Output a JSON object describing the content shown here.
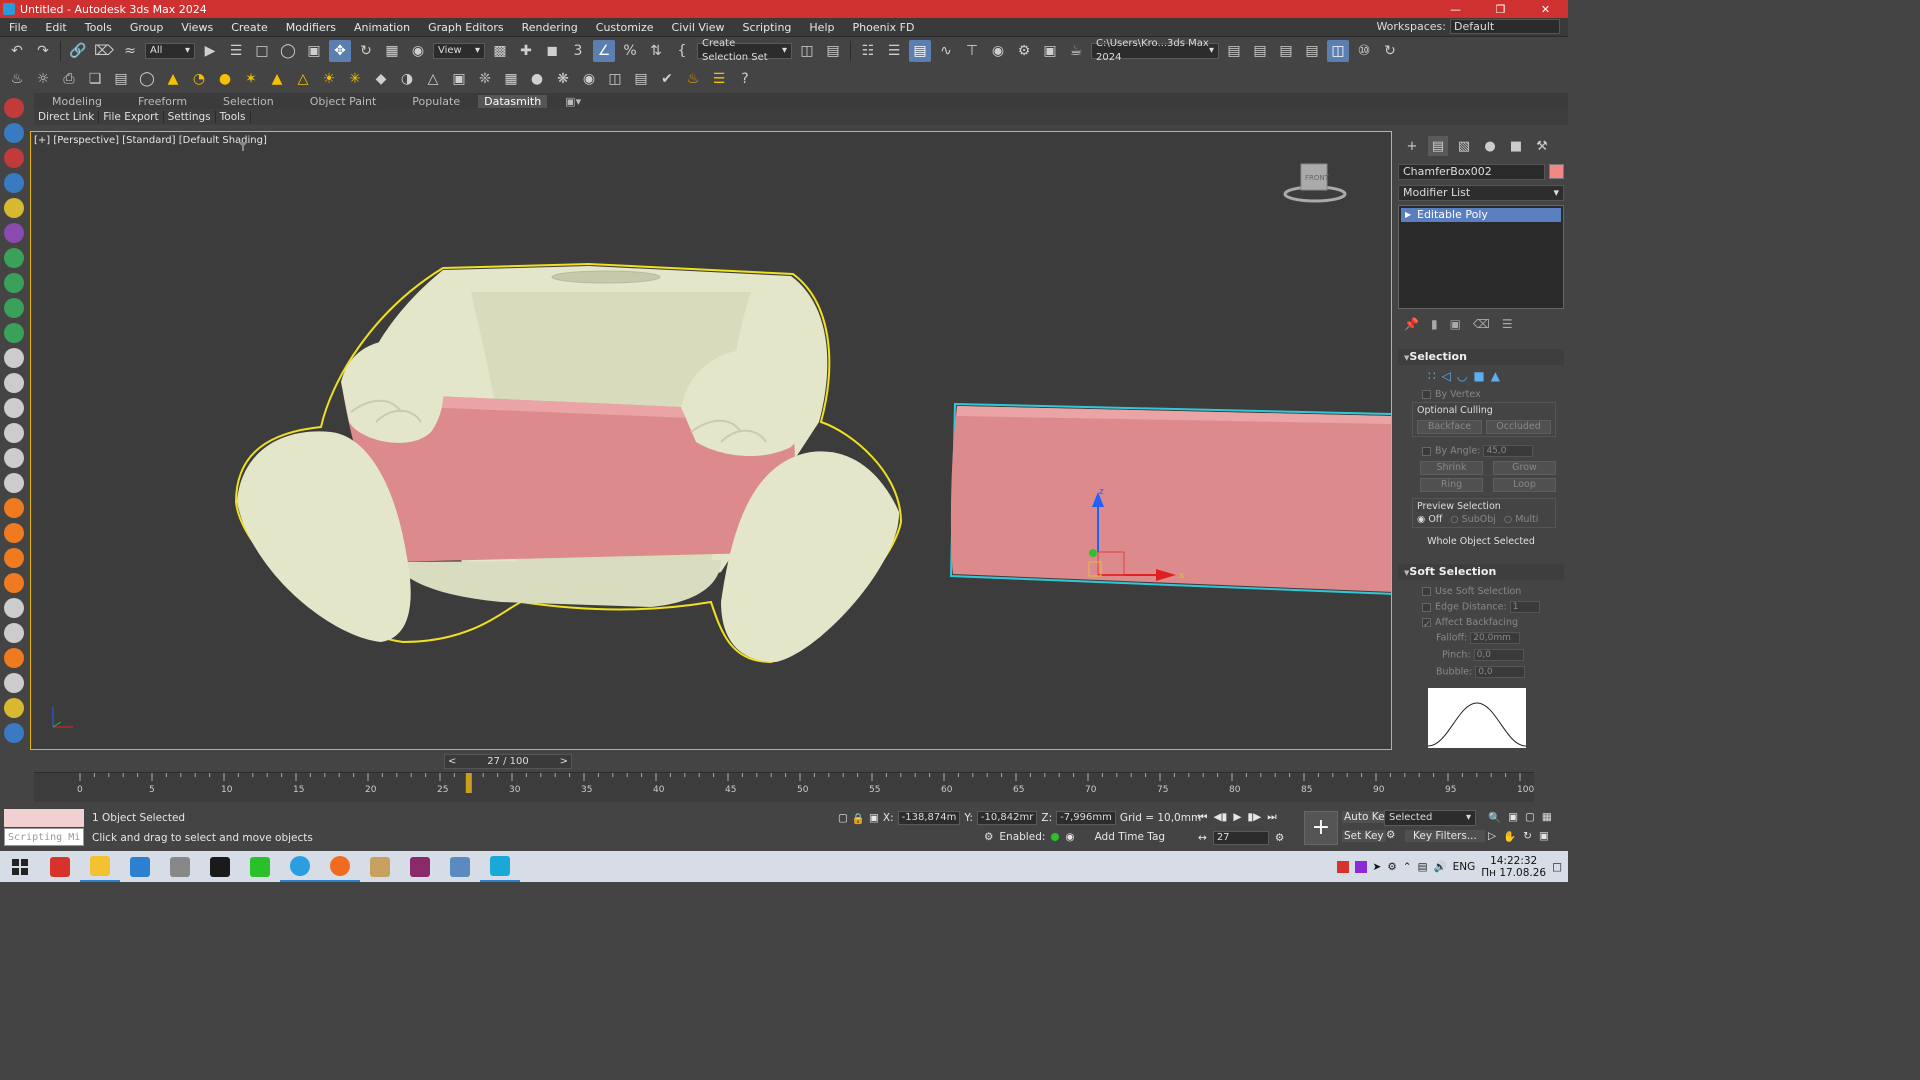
{
  "window": {
    "title": "Untitled - Autodesk 3ds Max 2024",
    "icon": "3dsmax-icon"
  },
  "menubar": {
    "items": [
      "File",
      "Edit",
      "Tools",
      "Group",
      "Views",
      "Create",
      "Modifiers",
      "Animation",
      "Graph Editors",
      "Rendering",
      "Customize",
      "Civil View",
      "Scripting",
      "Help",
      "Phoenix FD"
    ],
    "workspaces_label": "Workspaces:",
    "workspaces_value": "Default"
  },
  "toolbar": {
    "filter_value": "All",
    "ref_coord_value": "View",
    "selection_set_label": "Create Selection Set",
    "project_path": "C:\\Users\\Kro...3ds Max 2024"
  },
  "ribbon": {
    "tabs": [
      "Modeling",
      "Freeform",
      "Selection",
      "Object Paint",
      "Populate",
      "Datasmith"
    ],
    "active_tab": "Datasmith",
    "sub_tabs": [
      "Direct Link",
      "File Export",
      "Settings",
      "Tools"
    ]
  },
  "viewport": {
    "label": "[+] [Perspective] [Standard] [Default Shading]",
    "viewcube_label": "FRONT",
    "gizmo_labels": {
      "z": "z",
      "x": "x"
    },
    "colors": {
      "bear": "#e3e6c8",
      "box": "#dc8a8c",
      "selection_outline": "#f0e020",
      "box_outline": "#30c8d8"
    }
  },
  "command_panel": {
    "object_name": "ChamferBox002",
    "object_color": "#f08888",
    "modifier_list_label": "Modifier List",
    "stack_item": "Editable Poly",
    "selection": {
      "title": "Selection",
      "by_vertex": "By Vertex",
      "optional_culling": "Optional Culling",
      "backface": "Backface",
      "occluded": "Occluded",
      "by_angle": "By Angle:",
      "by_angle_value": "45,0",
      "shrink": "Shrink",
      "grow": "Grow",
      "ring": "Ring",
      "loop": "Loop",
      "preview_selection": "Preview Selection",
      "preview_off": "Off",
      "preview_subobj": "SubObj",
      "preview_multi": "Multi",
      "whole_object": "Whole Object Selected"
    },
    "soft_selection": {
      "title": "Soft Selection",
      "use_soft": "Use Soft Selection",
      "edge_distance": "Edge Distance:",
      "edge_distance_value": "1",
      "affect_backfacing": "Affect Backfacing",
      "falloff": "Falloff:",
      "falloff_value": "20,0mm",
      "pinch": "Pinch:",
      "pinch_value": "0,0",
      "bubble": "Bubble:",
      "bubble_value": "0,0"
    }
  },
  "timeline": {
    "slider_text": "27 / 100",
    "current_frame": 27,
    "ticks": [
      "0",
      "5",
      "10",
      "15",
      "20",
      "25",
      "30",
      "35",
      "40",
      "45",
      "50",
      "55",
      "60",
      "65",
      "70",
      "75",
      "80",
      "85",
      "90",
      "95",
      "100"
    ]
  },
  "status": {
    "objects_selected": "1 Object Selected",
    "prompt": "Click and drag to select and move objects",
    "maxscript_placeholder": "Scripting Mi",
    "x_label": "X:",
    "x_value": "-138,874m",
    "y_label": "Y:",
    "y_value": "-10,842mr",
    "z_label": "Z:",
    "z_value": "-7,996mm",
    "grid": "Grid = 10,0mm",
    "enabled_label": "Enabled:",
    "add_time_tag": "Add Time Tag",
    "auto_key": "Auto Key",
    "set_key": "Set Key",
    "selected_value": "Selected",
    "key_filters": "Key Filters...",
    "frame_value": "27"
  },
  "taskbar": {
    "language": "ENG",
    "time": "14:22:32",
    "date": "Пн 17.08.26"
  }
}
